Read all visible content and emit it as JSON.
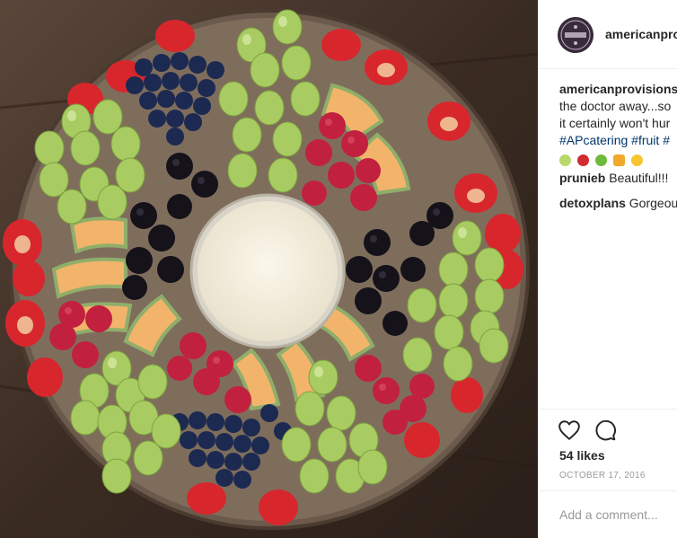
{
  "post": {
    "image": {
      "subject": "round fruit platter ring with dip bowl in center",
      "fruits": [
        "strawberries",
        "blueberries",
        "green grapes",
        "raspberries",
        "blackberries",
        "cantaloupe"
      ]
    },
    "header": {
      "avatar_name": "american-provisions-logo",
      "username": "americanprovisions"
    },
    "caption": {
      "username": "americanprovisions",
      "line2": "the doctor away...so",
      "line3": "it certainly won't hur",
      "hashtags": [
        "#APcatering",
        "#fruit",
        "#"
      ],
      "emoji_names": [
        "pear",
        "cherries",
        "apple",
        "honey-pot",
        "smiling-face"
      ]
    },
    "comments": [
      {
        "user": "prunieb",
        "text": "Beautiful!!!"
      },
      {
        "user": "detoxplans",
        "text": "Gorgeou"
      }
    ],
    "actions": {
      "like_icon": "heart-icon",
      "comment_icon": "comment-icon"
    },
    "likes_text": "54 likes",
    "date": "OCTOBER 17, 2016",
    "comment_input": {
      "placeholder": "Add a comment..."
    }
  },
  "colors": {
    "text": "#262626",
    "muted": "#999999",
    "hashtag": "#003569",
    "divider": "#efefef"
  }
}
